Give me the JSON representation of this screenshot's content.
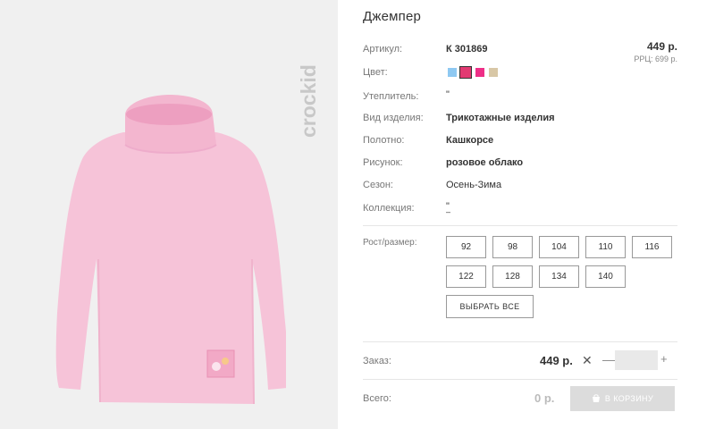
{
  "product": {
    "title": "Джемпер",
    "brand": "crockid",
    "price": "449 р.",
    "rrp": "РРЦ: 699 р."
  },
  "attributes": {
    "article": {
      "label": "Артикул:",
      "value": "К 301869"
    },
    "color": {
      "label": "Цвет:"
    },
    "insulation": {
      "label": "Утеплитель:",
      "value": "\""
    },
    "item_type": {
      "label": "Вид изделия:",
      "value": "Трикотажные изделия"
    },
    "fabric": {
      "label": "Полотно:",
      "value": "Кашкорсе"
    },
    "pattern": {
      "label": "Рисунок:",
      "value": "розовое облако"
    },
    "season": {
      "label": "Сезон:",
      "value": "Осень-Зима"
    },
    "collection": {
      "label": "Коллекция:",
      "value": "\"",
      "value2": "–"
    }
  },
  "swatches": [
    {
      "name": "light-blue",
      "color": "#8ec9f2",
      "selected": false
    },
    {
      "name": "crimson",
      "color": "#e23a72",
      "selected": true
    },
    {
      "name": "pink",
      "color": "#ee2f87",
      "selected": false
    },
    {
      "name": "beige",
      "color": "#d8c7a6",
      "selected": false
    }
  ],
  "sizes": {
    "label": "Рост/размер:",
    "row1": [
      "92",
      "98",
      "104",
      "110",
      "116"
    ],
    "row2": [
      "122",
      "128",
      "134",
      "140"
    ],
    "select_all": "ВЫБРАТЬ ВСЕ"
  },
  "order": {
    "label": "Заказ:",
    "price": "449 р.",
    "times": "✕",
    "minus": "—",
    "quantity": "",
    "plus": "+"
  },
  "total": {
    "label": "Всего:",
    "value": "0 р.",
    "cart_button": "В КОРЗИНУ"
  },
  "colors": {
    "sweater": "#f6c3d8",
    "background": "#f0f0f0",
    "logo": "#c8c8c8"
  }
}
